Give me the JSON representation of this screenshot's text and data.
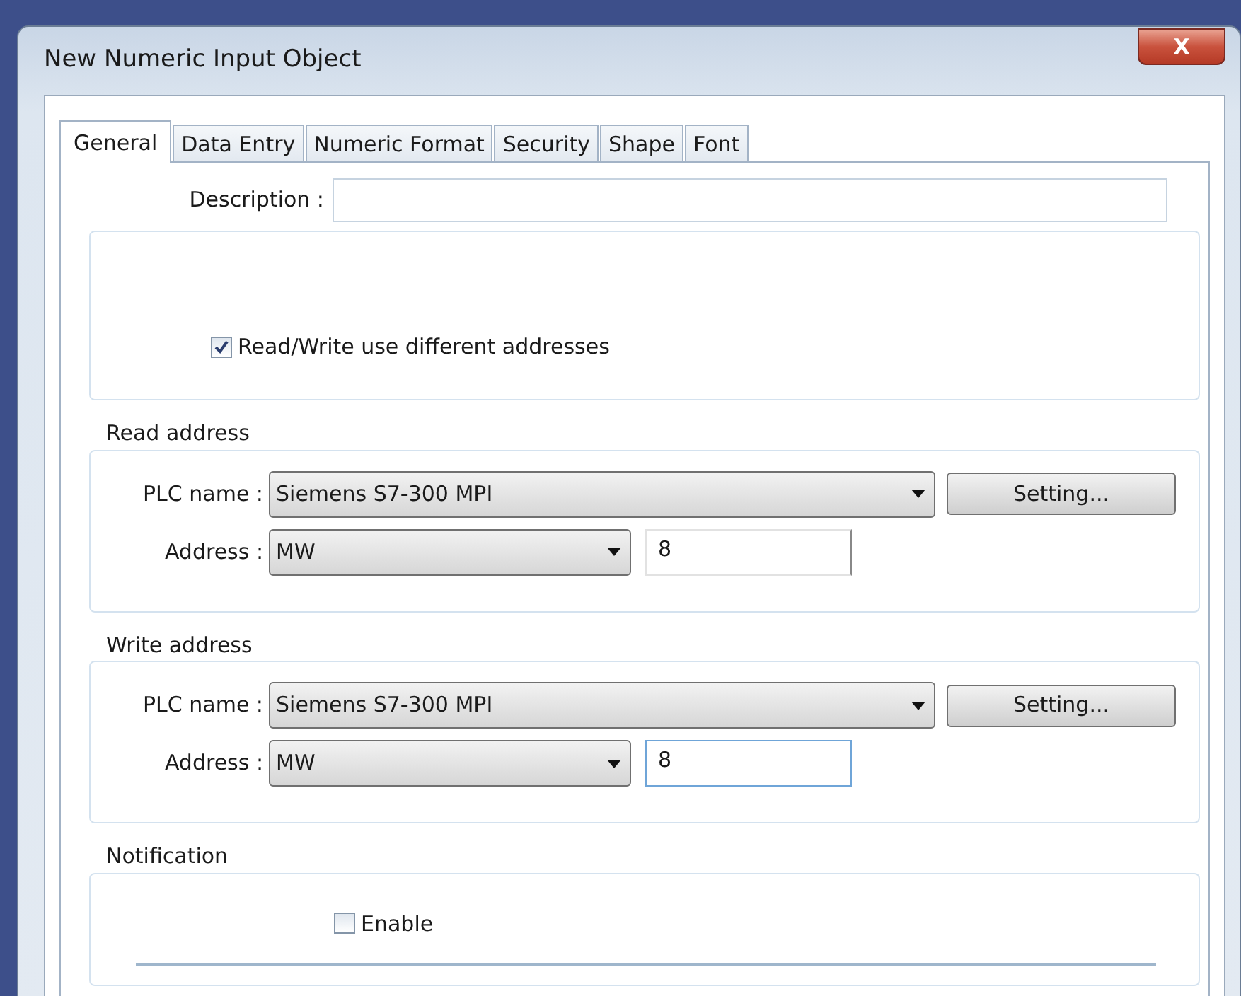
{
  "window": {
    "title": "New  Numeric Input Object",
    "close": "X"
  },
  "tabs": [
    {
      "label": "General",
      "selected": true
    },
    {
      "label": "Data Entry",
      "selected": false
    },
    {
      "label": "Numeric Format",
      "selected": false
    },
    {
      "label": "Security",
      "selected": false
    },
    {
      "label": "Shape",
      "selected": false
    },
    {
      "label": "Font",
      "selected": false
    }
  ],
  "description": {
    "label": "Description :"
  },
  "different_addresses": {
    "label": "Read/Write use different addresses",
    "checked": true
  },
  "address_groups": [
    {
      "legend": "Read address",
      "plc_label": "PLC name :",
      "plc_name": "Siemens S7-300 MPI",
      "setting_button": "Setting...",
      "address_label": "Address :",
      "address_type": "MW",
      "address_value": "8",
      "focused": false
    },
    {
      "legend": "Write address",
      "plc_label": "PLC name :",
      "plc_name": "Siemens S7-300 MPI",
      "setting_button": "Setting...",
      "address_label": "Address :",
      "address_type": "MW",
      "address_value": "8",
      "focused": true
    }
  ],
  "notification": {
    "legend": "Notification",
    "enable": {
      "label": "Enable",
      "checked": false
    }
  }
}
